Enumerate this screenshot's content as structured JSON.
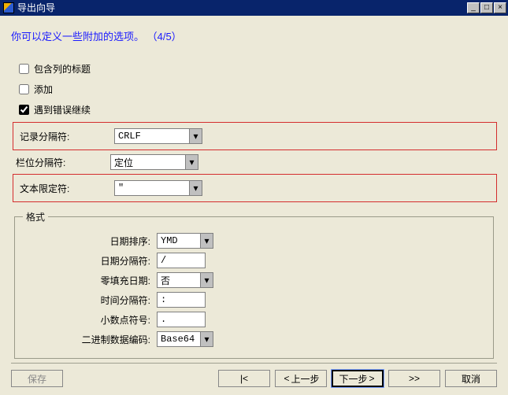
{
  "window": {
    "title": "导出向导"
  },
  "heading": "你可以定义一些附加的选项。 （4/5）",
  "checkboxes": {
    "include_headers": {
      "label": "包含列的标题",
      "checked": false
    },
    "append": {
      "label": "添加",
      "checked": false
    },
    "continue_on_error": {
      "label": "遇到错误继续",
      "checked": true
    }
  },
  "separators": {
    "record": {
      "label": "记录分隔符:",
      "value": "CRLF"
    },
    "field": {
      "label": "栏位分隔符:",
      "value": "定位"
    },
    "text_qualifier": {
      "label": "文本限定符:",
      "value": "\""
    }
  },
  "format_group": {
    "legend": "格式",
    "date_order": {
      "label": "日期排序:",
      "value": "YMD"
    },
    "date_sep": {
      "label": "日期分隔符:",
      "value": "/"
    },
    "zero_fill": {
      "label": "零填充日期:",
      "value": "否"
    },
    "time_sep": {
      "label": "时间分隔符:",
      "value": ":"
    },
    "decimal": {
      "label": "小数点符号:",
      "value": "."
    },
    "binary_enc": {
      "label": "二进制数据编码:",
      "value": "Base64"
    }
  },
  "buttons": {
    "save": "保存",
    "back": "上一步",
    "next": "下一步",
    "cancel": "取消"
  },
  "icons": {
    "first": "|<",
    "prev": "<",
    "next": ">",
    "last": ">>"
  }
}
